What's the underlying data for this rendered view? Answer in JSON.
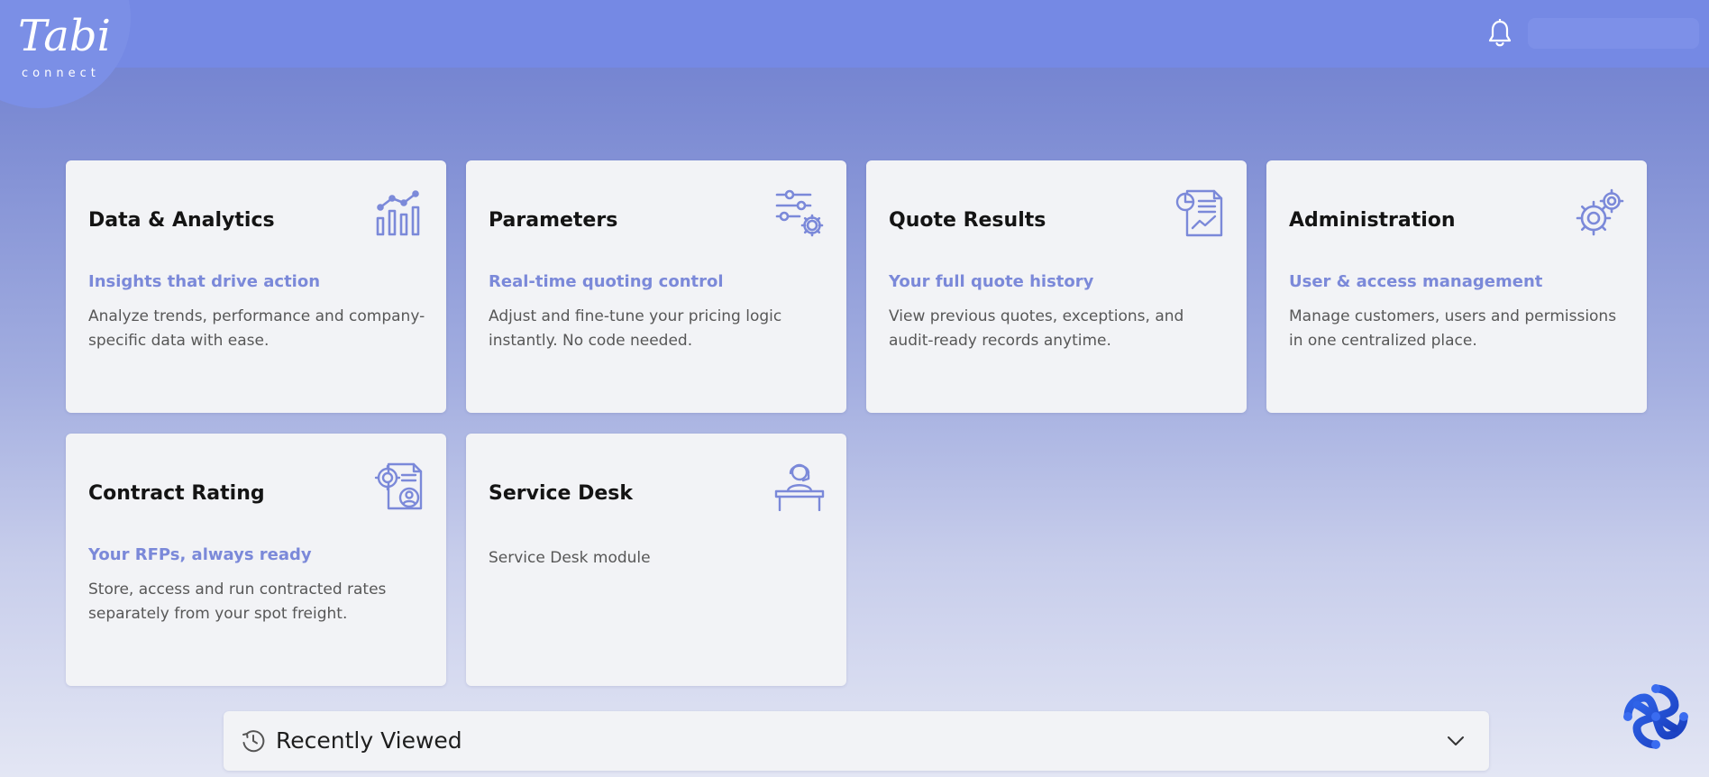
{
  "header": {
    "logo_main": "Tabi",
    "logo_sub": "connect"
  },
  "cards": [
    {
      "title": "Data & Analytics",
      "subtitle": "Insights that drive action",
      "description": "Analyze trends, performance and company-specific data with ease.",
      "icon": "analytics-chart-icon"
    },
    {
      "title": "Parameters",
      "subtitle": "Real-time quoting control",
      "description": "Adjust and fine-tune your pricing logic instantly. No code needed.",
      "icon": "sliders-gear-icon"
    },
    {
      "title": "Quote Results",
      "subtitle": "Your full quote history",
      "description": "View previous quotes, exceptions, and audit-ready records anytime.",
      "icon": "report-document-icon"
    },
    {
      "title": "Administration",
      "subtitle": "User & access management",
      "description": "Manage customers, users and permissions in one centralized place.",
      "icon": "gears-icon"
    },
    {
      "title": "Contract Rating",
      "subtitle": "Your RFPs, always ready",
      "description": "Store, access and run contracted rates separately from your spot freight.",
      "icon": "contract-document-icon"
    },
    {
      "title": "Service Desk",
      "subtitle": "",
      "description": "Service Desk module",
      "icon": "support-agent-desk-icon"
    }
  ],
  "recently_viewed": {
    "label": "Recently Viewed"
  },
  "colors": {
    "accent": "#7b89d9",
    "topbar": "#7589e4",
    "card_bg": "#f2f3f6"
  }
}
